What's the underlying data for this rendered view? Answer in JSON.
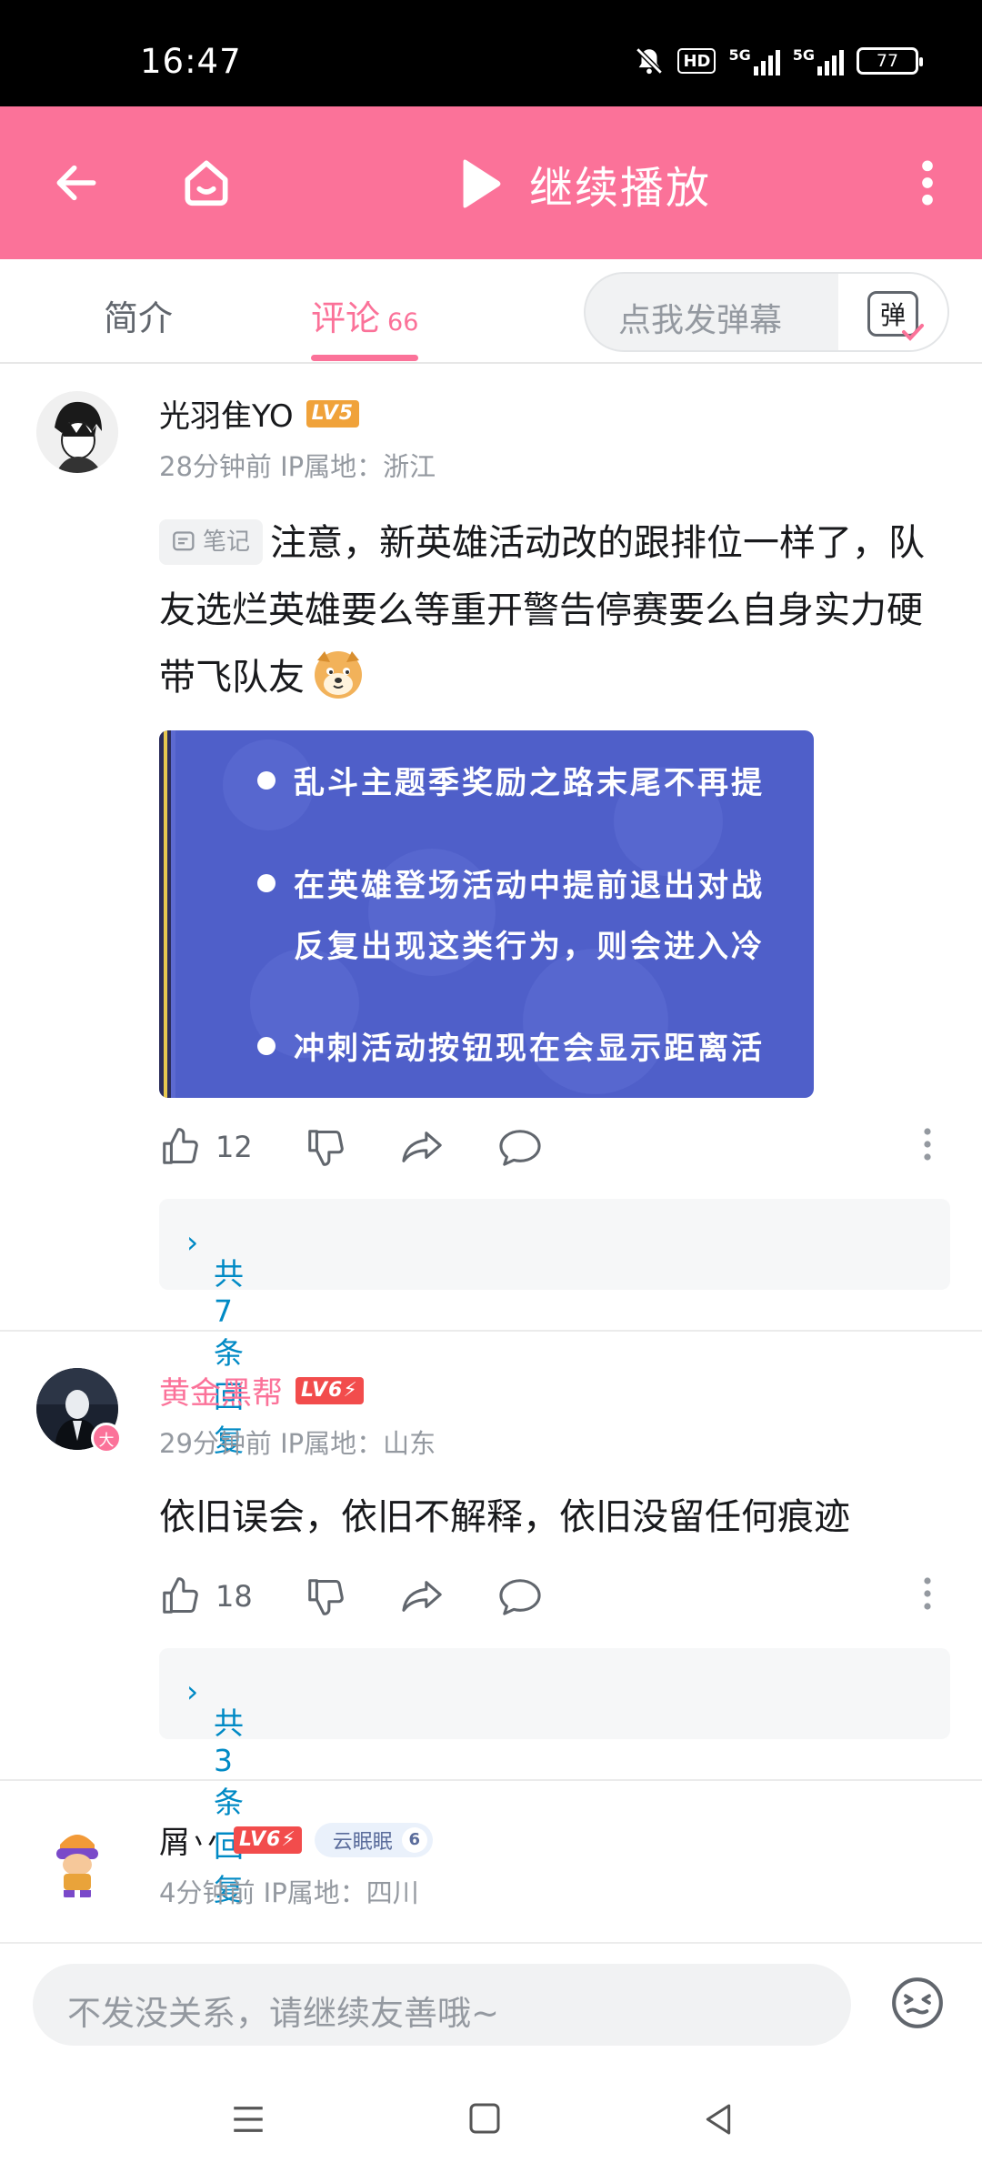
{
  "status_bar": {
    "time": "16:47",
    "network_1": "5G",
    "network_2": "5G",
    "hd_label": "HD",
    "battery": "77",
    "icons": [
      "mute-bell-icon",
      "hd-voice-icon",
      "signal-5g-icon",
      "signal-5g-icon",
      "battery-icon"
    ]
  },
  "header": {
    "play_label": "继续播放",
    "colors": {
      "background": "#fb7299",
      "foreground": "#ffffff"
    }
  },
  "tabs": {
    "intro": "简介",
    "comments": "评论",
    "comments_count": "66",
    "danmaku_placeholder": "点我发弹幕",
    "danmaku_button": "弹"
  },
  "comments": [
    {
      "username": "光羽隹YO",
      "level": "LV5",
      "meta": "28分钟前 IP属地：浙江",
      "note_tag": "笔记",
      "text": "注意，新英雄活动改的跟排位一样了，队友选烂英雄要么等重开警告停赛要么自身实力硬带飞队友",
      "image_lines": [
        "乱斗主题季奖励之路末尾不再提",
        "在英雄登场活动中提前退出对战",
        "反复出现这类行为，则会进入冷",
        "冲刺活动按钮现在会显示距离活"
      ],
      "likes": "12",
      "replies": "共7条回复"
    },
    {
      "username": "黄金黑帮",
      "level": "LV6",
      "avatar_badge": "大",
      "meta": "29分钟前 IP属地：山东",
      "text": "依旧误会，依旧不解释，依旧没留任何痕迹",
      "likes": "18",
      "replies": "共3条回复"
    },
    {
      "username": "屑丷",
      "level": "LV6",
      "fan_badge": "云眠眠",
      "fan_level": "6",
      "meta": "4分钟前 IP属地：四川"
    }
  ],
  "input_bar": {
    "placeholder": "不发没关系，请继续友善哦~"
  },
  "colors": {
    "accent": "#fb7299",
    "link": "#008ac5",
    "muted": "#9499a0",
    "lv5": "#f0a23a",
    "lv6": "#f24c4c"
  }
}
